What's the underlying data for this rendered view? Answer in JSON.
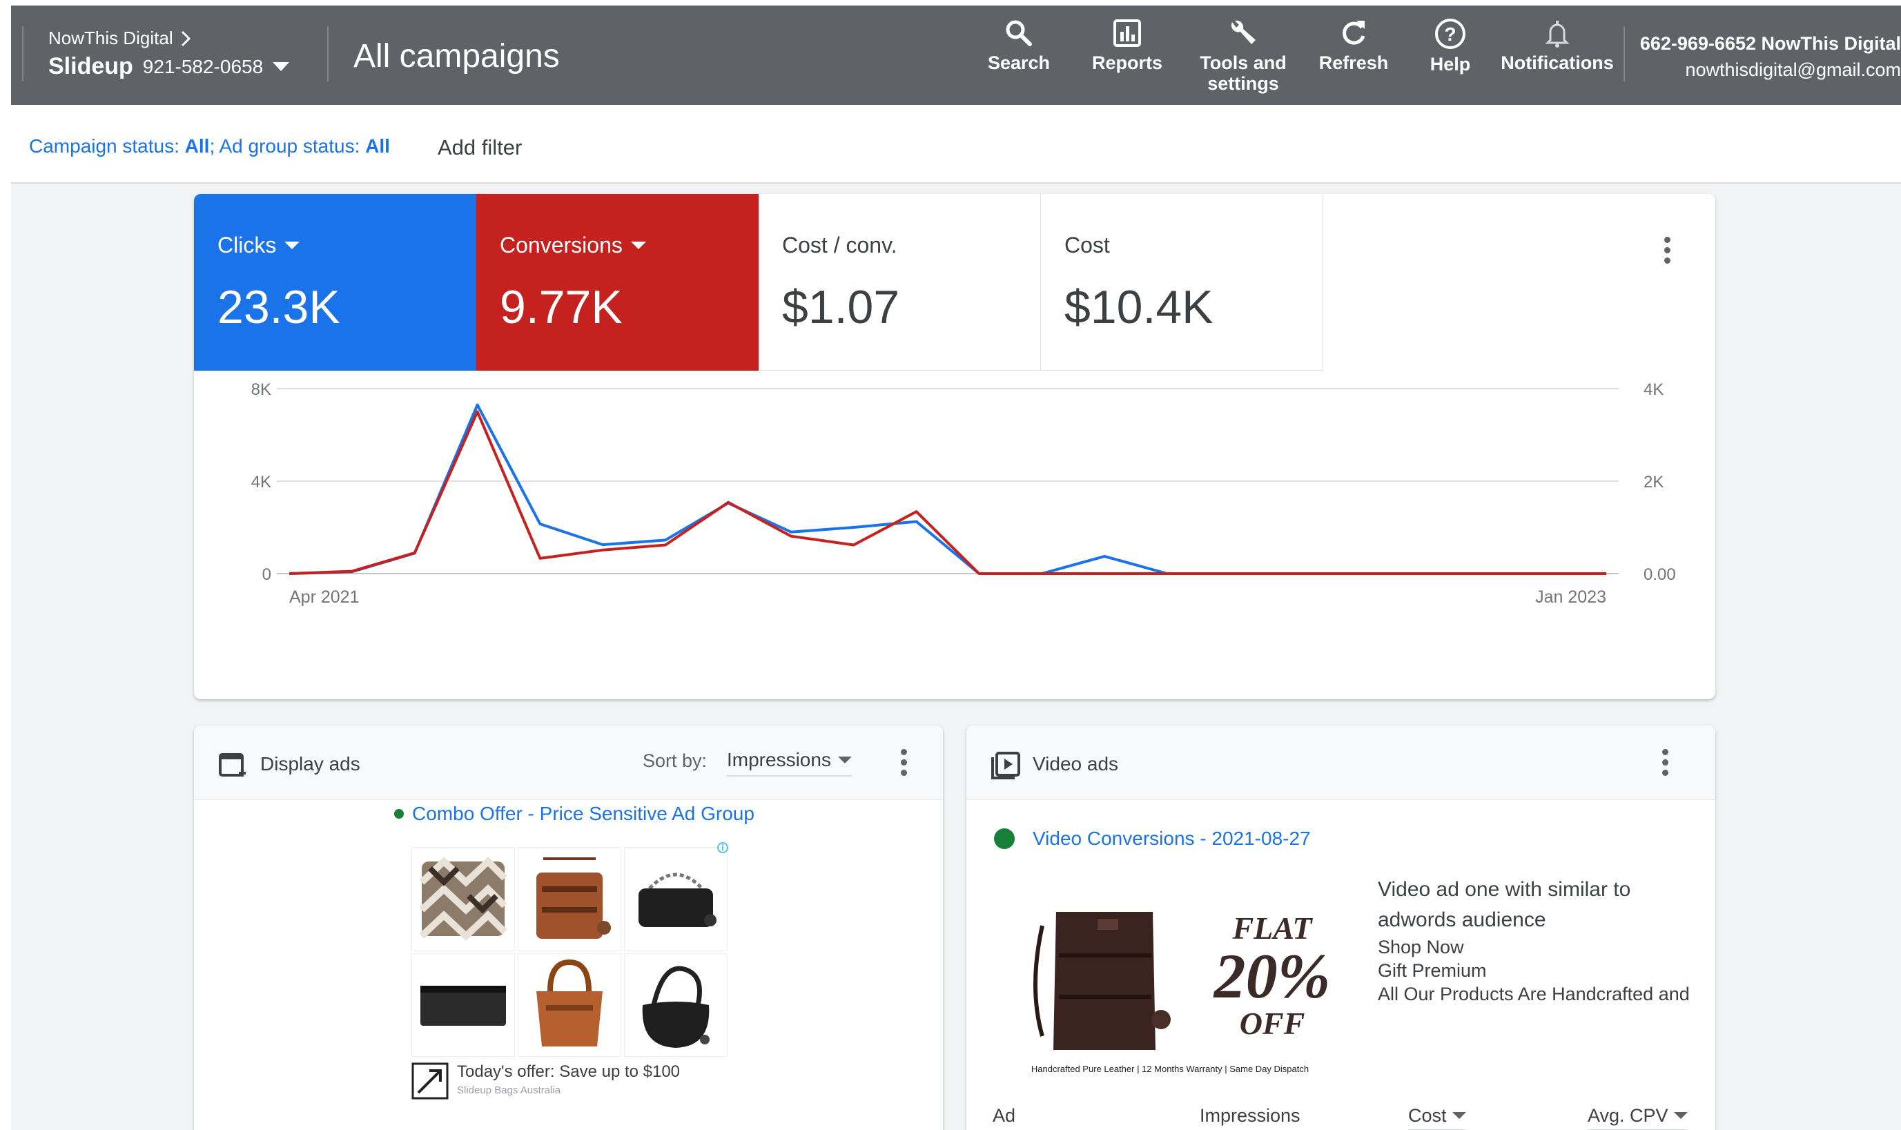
{
  "header": {
    "account_parent": "NowThis Digital",
    "account_name": "Slideup",
    "account_id": "921-582-0658",
    "page_title": "All campaigns",
    "nav": [
      {
        "label": "Search",
        "icon": "search-icon"
      },
      {
        "label": "Reports",
        "icon": "reports-icon"
      },
      {
        "label": "Tools and settings",
        "icon": "wrench-icon"
      },
      {
        "label": "Refresh",
        "icon": "refresh-icon"
      },
      {
        "label": "Help",
        "icon": "help-icon"
      },
      {
        "label": "Notifications",
        "icon": "bell-icon"
      }
    ],
    "user_account": "662-969-6652 NowThis Digital",
    "user_email": "nowthisdigital@gmail.com"
  },
  "filters": {
    "campaign_status_label": "Campaign status: ",
    "campaign_status_value": "All",
    "separator": "; ",
    "ad_group_status_label": "Ad group status: ",
    "ad_group_status_value": "All",
    "add_filter": "Add filter"
  },
  "metrics": [
    {
      "label": "Clicks",
      "value": "23.3K",
      "color": "#1a73e8"
    },
    {
      "label": "Conversions",
      "value": "9.77K",
      "color": "#c5221f"
    },
    {
      "label": "Cost / conv.",
      "value": "$1.07"
    },
    {
      "label": "Cost",
      "value": "$10.4K"
    }
  ],
  "chart_data": {
    "type": "line",
    "x_start_label": "Apr 2021",
    "x_end_label": "Jan 2023",
    "y_left_ticks": [
      "8K",
      "4K",
      "0"
    ],
    "y_right_ticks": [
      "4K",
      "2K",
      "0.00"
    ],
    "y_left_range": [
      0,
      8000
    ],
    "y_right_range": [
      0,
      4000
    ],
    "grid": true,
    "series": [
      {
        "name": "Clicks",
        "axis": "left",
        "color": "#1a73e8",
        "values": [
          0,
          80,
          880,
          7300,
          2150,
          1250,
          1450,
          3050,
          1800,
          2000,
          2250,
          0,
          0,
          750,
          0,
          0,
          0,
          0,
          0,
          0,
          0,
          0
        ]
      },
      {
        "name": "Conversions",
        "axis": "right",
        "color": "#c5221f",
        "values": [
          0,
          50,
          450,
          3500,
          330,
          510,
          620,
          1540,
          810,
          620,
          1340,
          0,
          0,
          0,
          0,
          0,
          0,
          0,
          0,
          0,
          0,
          0
        ]
      }
    ]
  },
  "display_ads": {
    "title": "Display ads",
    "sort_label": "Sort by:",
    "sort_value": "Impressions",
    "ad_name": "Combo Offer - Price Sensitive Ad Group",
    "offer_text": "Today's offer: Save up to $100",
    "offer_source": "Slideup Bags Australia"
  },
  "video_ads": {
    "title": "Video ads",
    "ad_name": "Video Conversions - 2021-08-27",
    "thumb_flat": "FLAT",
    "thumb_percent": "20%",
    "thumb_off": "OFF",
    "thumb_caption": "Handcrafted Pure Leather | 12 Months Warranty | Same Day Dispatch",
    "headline": "Video ad one with similar to adwords audience",
    "line1": "Shop Now",
    "line2": "Gift Premium",
    "line3": "All Our Products Are Handcrafted and",
    "columns": [
      "Ad",
      "Impressions",
      "Cost",
      "Avg. CPV"
    ]
  }
}
